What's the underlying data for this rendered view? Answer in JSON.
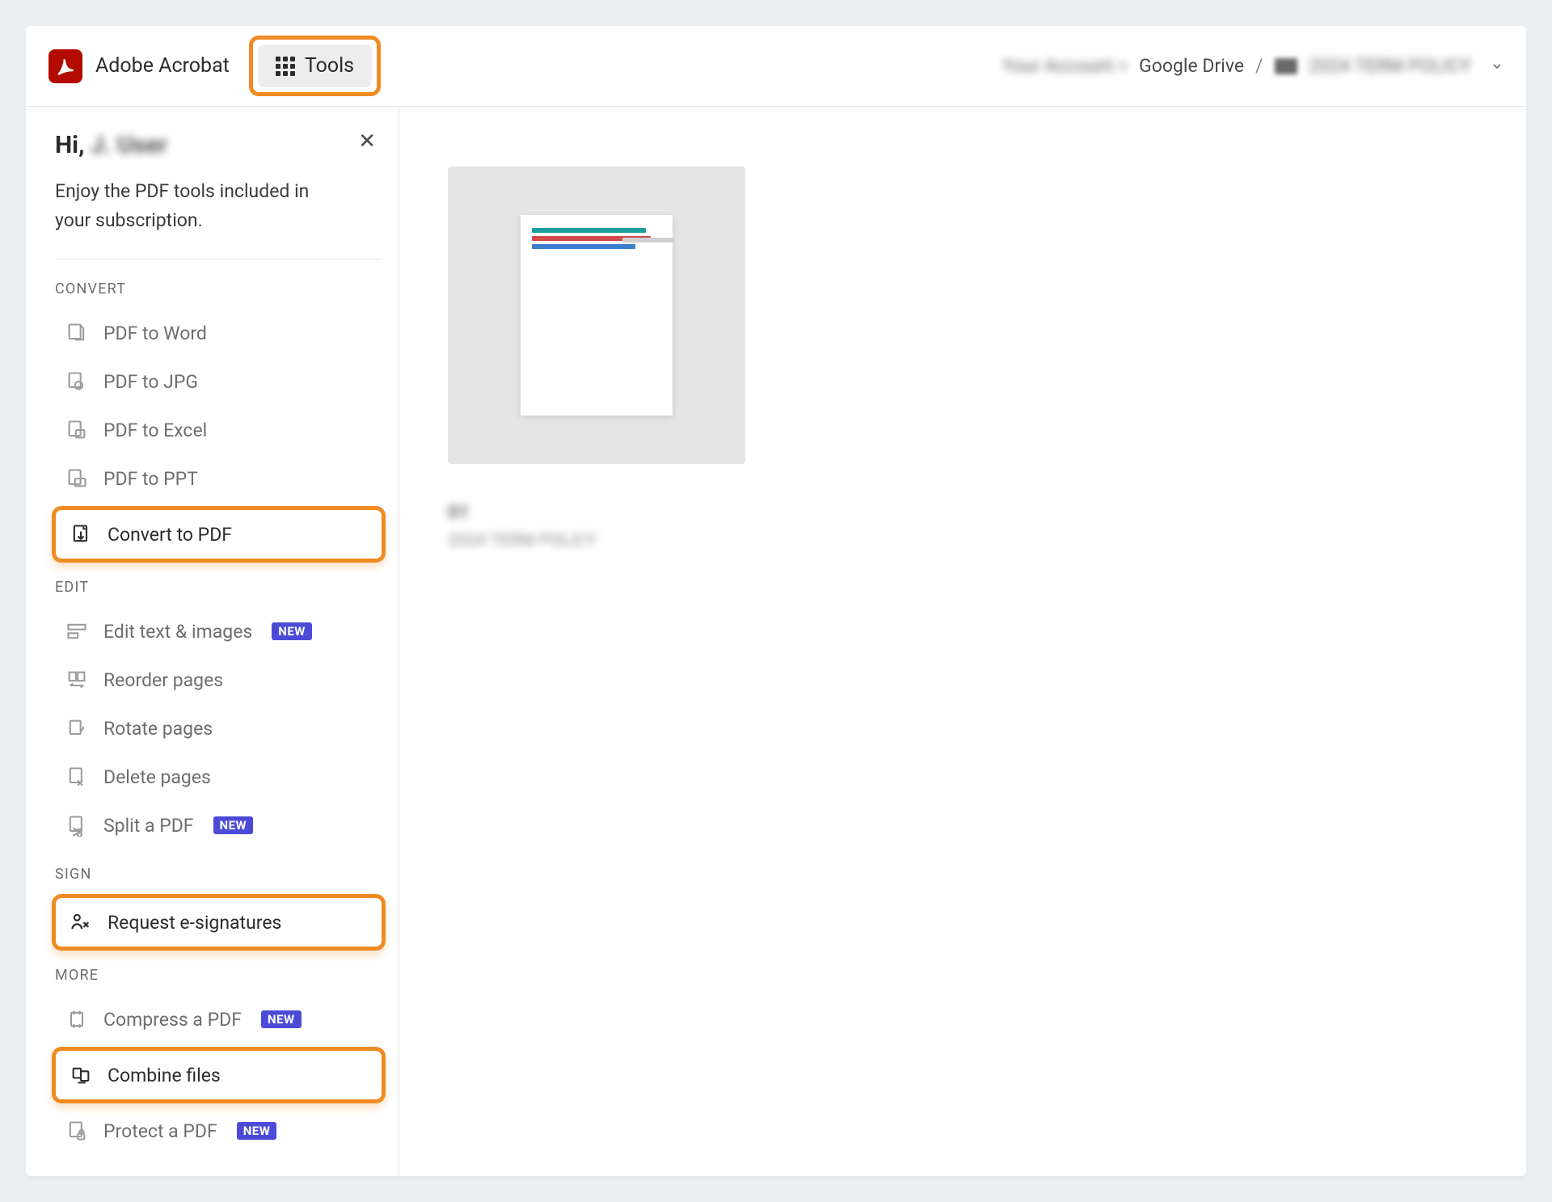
{
  "header": {
    "app_name": "Adobe Acrobat",
    "tools_label": "Tools",
    "breadcrumb": {
      "account_pre": "Your Account >",
      "drive": "Google Drive",
      "sep": "/",
      "file_name": "2024 TERM POLICY"
    }
  },
  "sidebar": {
    "greeting_prefix": "Hi,",
    "greeting_name": "J. User",
    "subtext": "Enjoy the PDF tools included in your subscription.",
    "sections": {
      "convert": {
        "label": "CONVERT",
        "items": [
          {
            "label": "PDF to Word",
            "badge": ""
          },
          {
            "label": "PDF to JPG",
            "badge": ""
          },
          {
            "label": "PDF to Excel",
            "badge": ""
          },
          {
            "label": "PDF to PPT",
            "badge": ""
          },
          {
            "label": "Convert to PDF",
            "badge": ""
          }
        ]
      },
      "edit": {
        "label": "EDIT",
        "items": [
          {
            "label": "Edit text & images",
            "badge": "NEW"
          },
          {
            "label": "Reorder pages",
            "badge": ""
          },
          {
            "label": "Rotate pages",
            "badge": ""
          },
          {
            "label": "Delete pages",
            "badge": ""
          },
          {
            "label": "Split a PDF",
            "badge": "NEW"
          }
        ]
      },
      "sign": {
        "label": "SIGN",
        "items": [
          {
            "label": "Request e-signatures",
            "badge": ""
          }
        ]
      },
      "more": {
        "label": "MORE",
        "items": [
          {
            "label": "Compress a PDF",
            "badge": "NEW"
          },
          {
            "label": "Combine files",
            "badge": ""
          },
          {
            "label": "Protect a PDF",
            "badge": "NEW"
          }
        ]
      }
    },
    "badge_text": "NEW"
  },
  "main": {
    "file_title": "01",
    "file_subtitle": "2024 TERM POLICY"
  }
}
